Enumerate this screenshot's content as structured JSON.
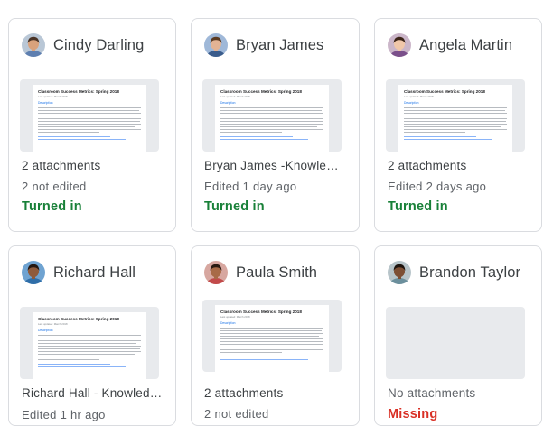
{
  "document": {
    "title": "Classroom Success Metrics: Spring 2018",
    "subtitle": "Last updated: March 2018",
    "section": "Description"
  },
  "colors": {
    "turned_in": "#188038",
    "missing": "#d93025",
    "secondary_text": "#5f6368"
  },
  "cards": [
    {
      "student": "Cindy Darling",
      "line1": "2 attachments",
      "line2": "2 not edited",
      "status": "Turned in",
      "status_color": "#188038",
      "avatar_icon": "student-avatar-icon",
      "has_thumbnail": true
    },
    {
      "student": "Bryan James",
      "line1": "Bryan James -Knowledg...",
      "line2": "Edited 1 day ago",
      "status": "Turned in",
      "status_color": "#188038",
      "avatar_icon": "student-avatar-icon",
      "has_thumbnail": true
    },
    {
      "student": "Angela Martin",
      "line1": "2 attachments",
      "line2": "Edited 2 days ago",
      "status": "Turned in",
      "status_color": "#188038",
      "avatar_icon": "student-avatar-icon",
      "has_thumbnail": true
    },
    {
      "student": "Richard Hall",
      "line1": "Richard Hall  - Knowledg...",
      "line2": "Edited 1 hr ago",
      "status": "",
      "status_color": "#188038",
      "avatar_icon": "student-avatar-icon",
      "has_thumbnail": true
    },
    {
      "student": "Paula Smith",
      "line1": "2 attachments",
      "line2": "2 not edited",
      "status": "",
      "status_color": "#188038",
      "avatar_icon": "student-avatar-icon",
      "has_thumbnail": true
    },
    {
      "student": "Brandon Taylor",
      "line1": "No attachments",
      "line2": "Missing",
      "status": "",
      "status_color": "#d93025",
      "avatar_icon": "student-avatar-icon",
      "has_thumbnail": false
    }
  ]
}
